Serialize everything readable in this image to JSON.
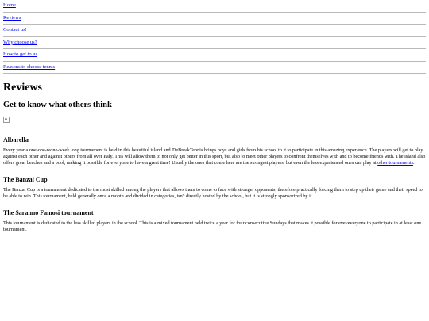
{
  "nav": {
    "items": [
      {
        "label": "Home"
      },
      {
        "label": "Reviews"
      },
      {
        "label": "Contact us!"
      },
      {
        "label": "Why choose us?"
      },
      {
        "label": "How to get to us"
      },
      {
        "label": "Reasons to choose tennis"
      }
    ]
  },
  "main": {
    "title": "Reviews",
    "subtitle": "Get to know what others think",
    "sections": [
      {
        "heading": "Albarella",
        "text": "Every year a one-one-wone-week long tournament is held in this beautiful island and TieBreakTennis brings boys and girls from his school to it to participate in this amazing experience. The players will get to play against each other and against others from all over Italy. This will allow them to not only get better in this sport, but also to meet other players to confront themselves with and to become friends with. The island also offers great beaches and a pool, making it possible for everyone to have a great time! Usually the ones that come here are the strongest players, but even the less experienced ones can play at ",
        "link": "other tournaments",
        "tail": "."
      },
      {
        "heading": "The Banzai Cup",
        "text": "The Banzai Cup is a tournament dedicated to the most skilled among the players that allows them to come to face with stronger opponents, therefore practically forcing them to step up their game and their speed to be able to win. This tournament, held generally once a month and divided in categories, isn't directly hosted by the school, but it is strongly sponsorized by it."
      },
      {
        "heading": "The Saranno Famosi tournament",
        "text": "This tournament is dedicated to the less skilled players in the school. This is a mixed tournament held twice a year for four consecutive Sundays that makes it possible for eveveveryone to participate in at least one tournament."
      }
    ]
  }
}
